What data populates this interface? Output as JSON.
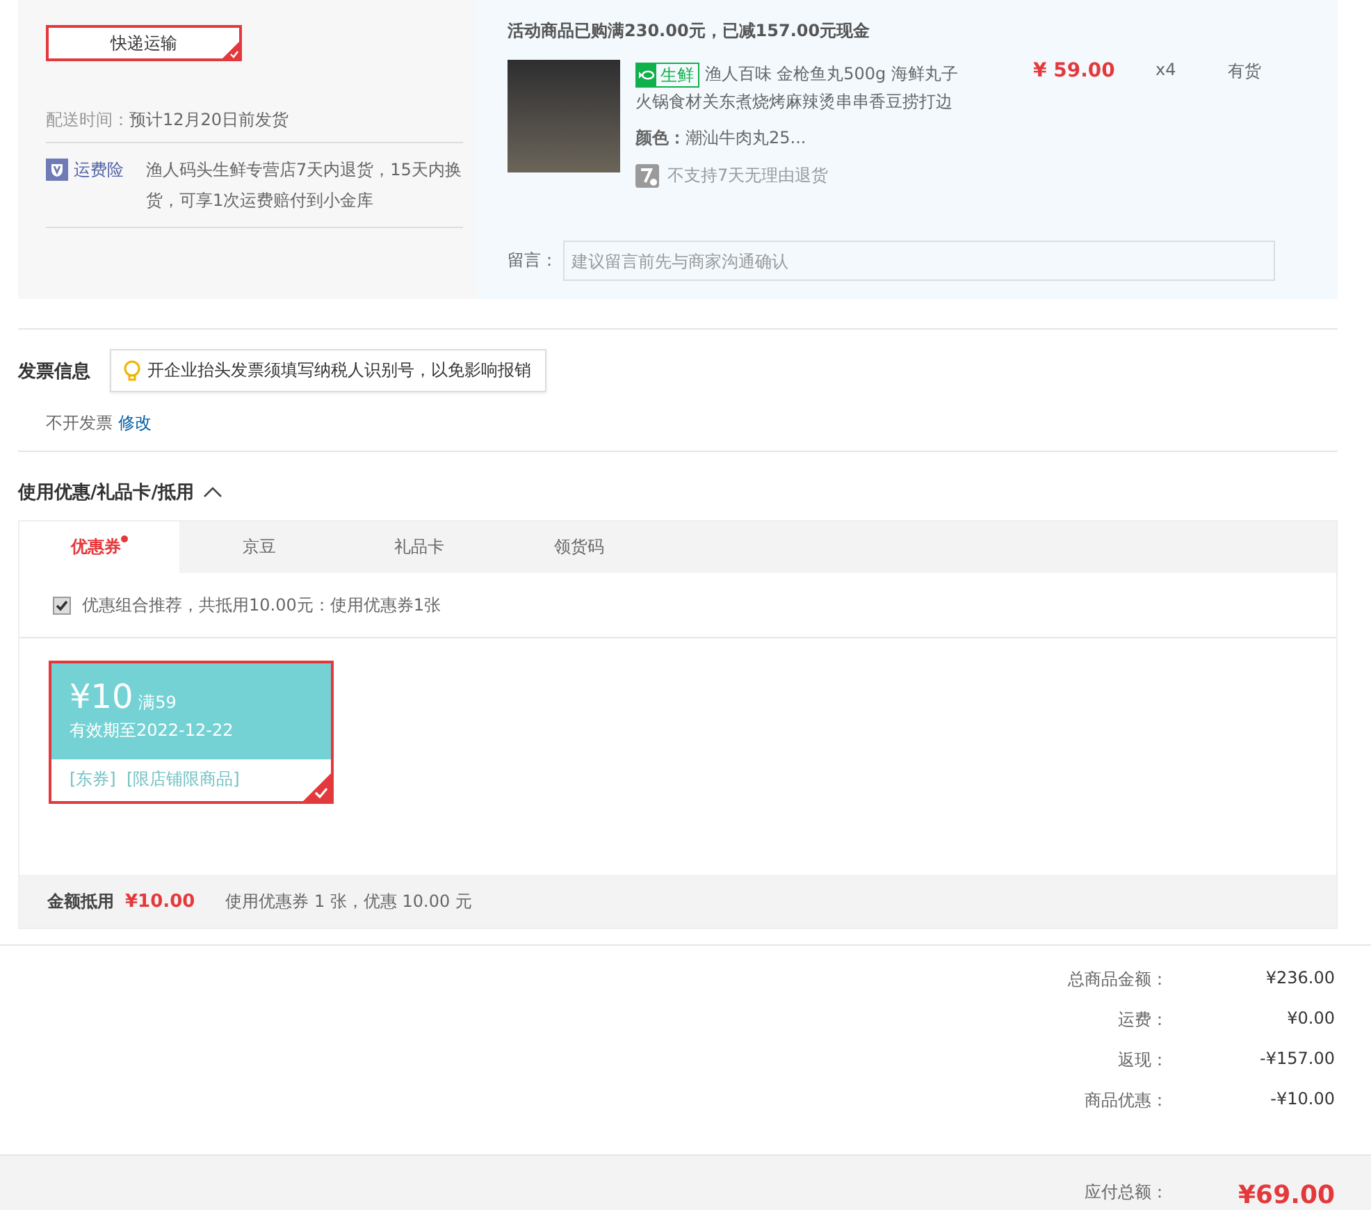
{
  "shipping": {
    "option": "快递运输",
    "selected": true,
    "delivery_label": "配送时间：",
    "delivery_value": "预计12月20日前发货",
    "insurance_label": "运费险",
    "insurance_text": "渔人码头生鲜专营店7天内退货，15天内换货，可享1次运费赔付到小金库"
  },
  "order": {
    "promo": "活动商品已购满230.00元，已减157.00元现金",
    "item": {
      "tag": "生鲜",
      "title_lines": [
        "渔人百味 金枪鱼丸500g 海鲜丸子",
        "火锅食材关东煮烧烤麻辣烫串串香豆捞打边"
      ],
      "color_label": "颜色：",
      "color_value": "潮汕牛肉丸25...",
      "return_note": "不支持7天无理由退货",
      "price": "¥ 59.00",
      "qty": "x4",
      "stock": "有货"
    },
    "remark_label": "留言：",
    "remark_placeholder": "建议留言前先与商家沟通确认"
  },
  "invoice": {
    "title": "发票信息",
    "tip": "开企业抬头发票须填写纳税人识别号，以免影响报销",
    "value": "不开发票",
    "edit_link": "修改"
  },
  "discounts": {
    "title": "使用优惠/礼品卡/抵用",
    "expanded": true,
    "tabs": [
      {
        "label": "优惠券",
        "selected": true,
        "dot": true
      },
      {
        "label": "京豆",
        "selected": false,
        "dot": false
      },
      {
        "label": "礼品卡",
        "selected": false,
        "dot": false
      },
      {
        "label": "领货码",
        "selected": false,
        "dot": false
      }
    ],
    "combo": {
      "checked": true,
      "text": "优惠组合推荐，共抵用10.00元：使用优惠券1张"
    },
    "coupons": [
      {
        "amount": "¥10",
        "condition": "满59",
        "validity": "有效期至2022-12-22",
        "tags": "[东券]  [限店铺限商品]",
        "selected": true
      }
    ],
    "footer": {
      "label": "金额抵用",
      "amount": "¥10.00",
      "note": "使用优惠券 1 张，优惠 10.00 元"
    }
  },
  "summary": [
    {
      "label": "总商品金额：",
      "value": "¥236.00"
    },
    {
      "label": "运费：",
      "value": "¥0.00"
    },
    {
      "label": "返现：",
      "value": "-¥157.00"
    },
    {
      "label": "商品优惠：",
      "value": "-¥10.00"
    }
  ],
  "total": {
    "label": "应付总额：",
    "value": "¥69.00"
  }
}
